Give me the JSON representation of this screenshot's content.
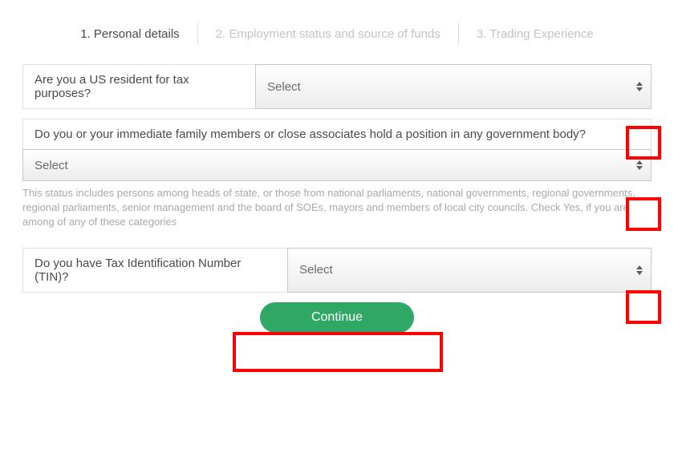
{
  "stepper": {
    "steps": [
      {
        "label": "1. Personal details",
        "active": true
      },
      {
        "label": "2. Employment status and source of funds",
        "active": false
      },
      {
        "label": "3. Trading Experience",
        "active": false
      }
    ]
  },
  "fields": {
    "us_resident": {
      "label": "Are you a US resident for tax purposes?",
      "selected": "Select"
    },
    "gov_position": {
      "label": "Do you or your immediate family members or close associates hold a position in any government body?",
      "selected": "Select",
      "helper": "This status includes persons among heads of state, or those from national parliaments, national governments, regional governments, regional parliaments, senior management and the board of SOEs, mayors and members of local city councils. Check Yes, if you are among of any of these categories"
    },
    "tin": {
      "label": "Do you have Tax Identification Number (TIN)?",
      "selected": "Select"
    }
  },
  "actions": {
    "continue_label": "Continue"
  }
}
